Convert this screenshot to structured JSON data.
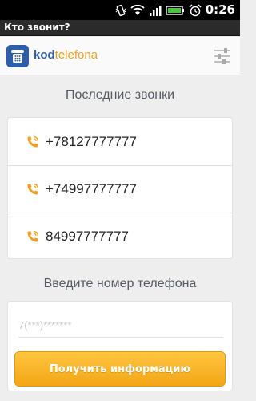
{
  "status_bar": {
    "time": "0:26",
    "icons": [
      "vibrate-icon",
      "wifi-icon",
      "signal-icon",
      "battery-icon",
      "alarm-icon"
    ]
  },
  "window": {
    "title": "Кто звонит?"
  },
  "header": {
    "logo_part1": "kod",
    "logo_part2": "telefona",
    "settings_icon": "settings-sliders-icon"
  },
  "recent": {
    "title": "Последние звонки",
    "items": [
      {
        "number": "+78127777777"
      },
      {
        "number": "+74997777777"
      },
      {
        "number": "84997777777"
      }
    ]
  },
  "lookup": {
    "title": "Введите номер телефона",
    "placeholder": "7(***)*******",
    "value": "",
    "button_label": "Получить информацию"
  },
  "colors": {
    "brand_blue": "#2f5ea8",
    "brand_orange": "#f0a020",
    "button": "#f3a514"
  }
}
